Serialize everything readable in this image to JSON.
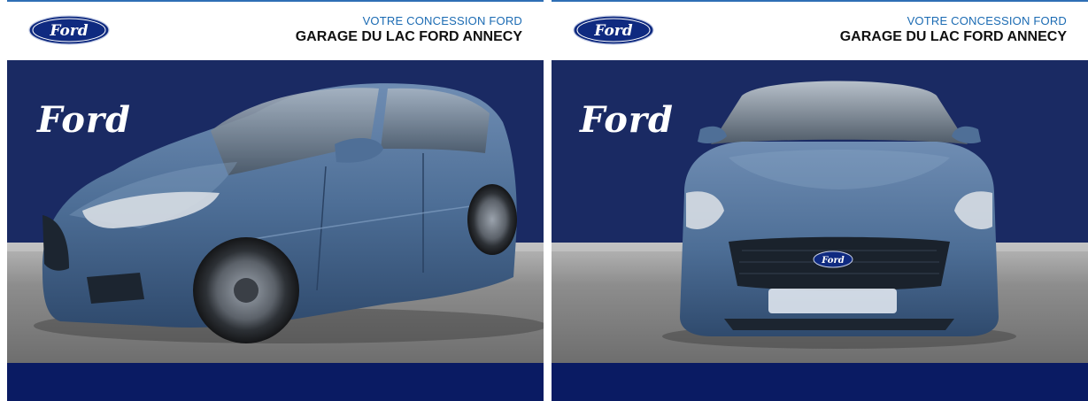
{
  "panels": [
    {
      "dealer_tagline": "VOTRE CONCESSION FORD",
      "dealer_name": "GARAGE DU LAC FORD ANNECY",
      "logo_text": "Ford",
      "backdrop_script": "Ford",
      "view": "front-three-quarter"
    },
    {
      "dealer_tagline": "VOTRE CONCESSION FORD",
      "dealer_name": "GARAGE DU LAC FORD ANNECY",
      "logo_text": "Ford",
      "backdrop_script": "Ford",
      "grille_badge_text": "Ford",
      "view": "front"
    }
  ],
  "colors": {
    "brand_blue": "#1b6bb3",
    "backdrop_navy": "#1a2a63",
    "footer_navy": "#0a1b63",
    "car_blue": "#4e6f96",
    "ground_gray": "#8c8c8c"
  }
}
